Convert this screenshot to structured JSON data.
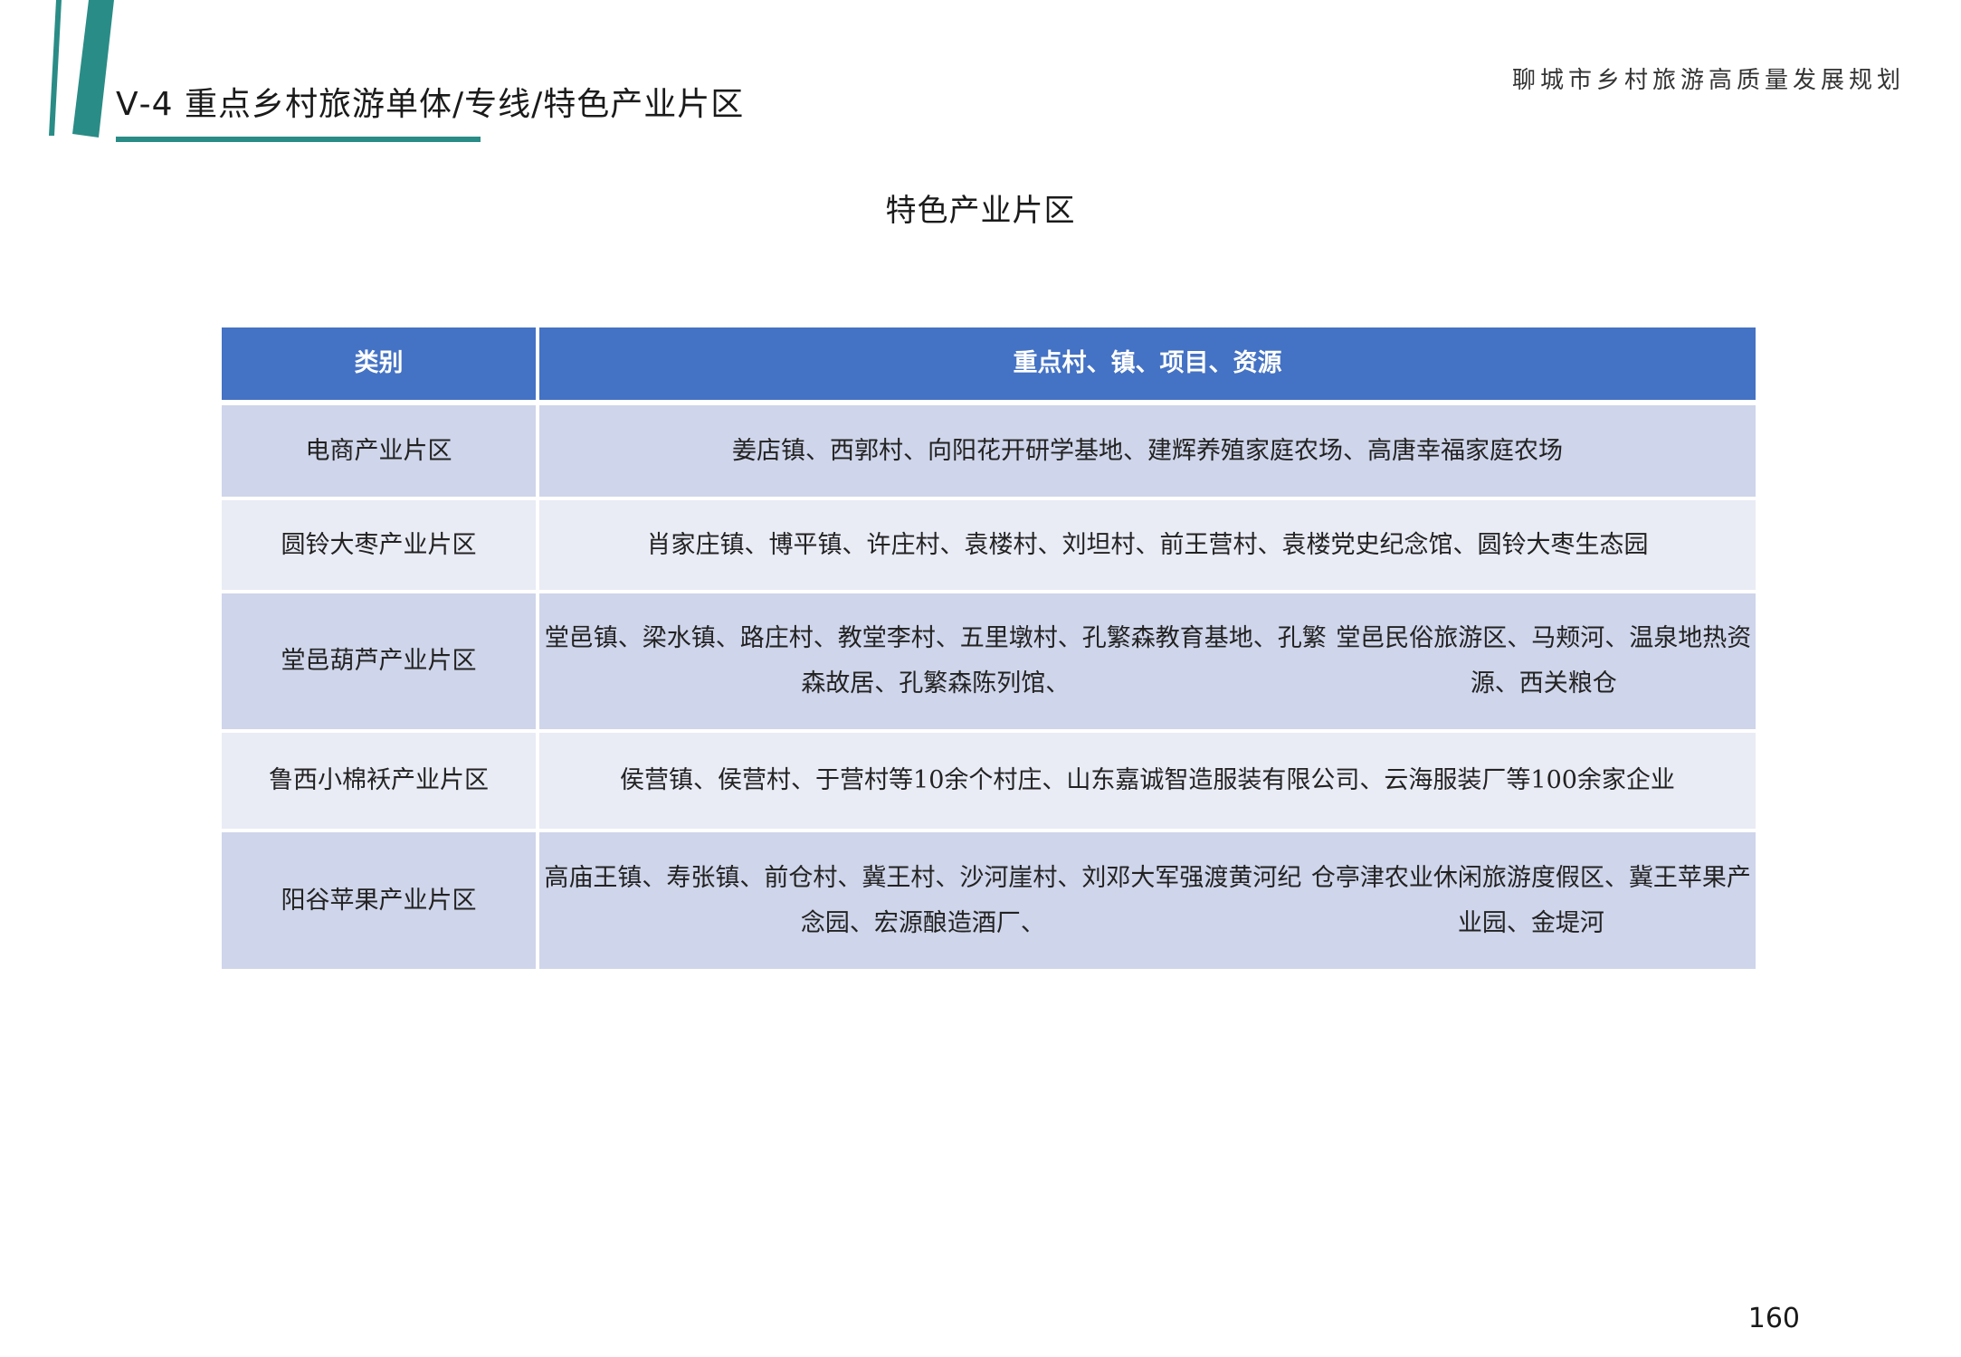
{
  "header": {
    "section_title": "Ⅴ-4 重点乡村旅游单体/专线/特色产业片区",
    "doc_title": "聊城市乡村旅游高质量发展规划"
  },
  "table_title": "特色产业片区",
  "table": {
    "headers": [
      "类别",
      "重点村、镇、项目、资源"
    ],
    "rows": [
      {
        "category": "电商产业片区",
        "lines": [
          "姜店镇、西郭村、向阳花开研学基地、建辉养殖家庭农场、高唐幸福家庭农场"
        ]
      },
      {
        "category": "圆铃大枣产业片区",
        "lines": [
          "肖家庄镇、博平镇、许庄村、袁楼村、刘坦村、前王营村、袁楼党史纪念馆、圆铃大枣生态园"
        ]
      },
      {
        "category": "堂邑葫芦产业片区",
        "lines": [
          "堂邑镇、梁水镇、路庄村、教堂李村、五里墩村、孔繁森教育基地、孔繁森故居、孔繁森陈列馆、",
          "堂邑民俗旅游区、马颊河、温泉地热资源、西关粮仓"
        ]
      },
      {
        "category": "鲁西小棉袄产业片区",
        "lines": [
          "侯营镇、侯营村、于营村等10余个村庄、山东嘉诚智造服装有限公司、云海服装厂等100余家企业"
        ]
      },
      {
        "category": "阳谷苹果产业片区",
        "lines": [
          "高庙王镇、寿张镇、前仓村、冀王村、沙河崖村、刘邓大军强渡黄河纪念园、宏源酿造酒厂、",
          "仓亭津农业休闲旅游度假区、冀王苹果产业园、金堤河"
        ]
      }
    ]
  },
  "page_number": "160",
  "colors": {
    "accent_teal": "#2a8c86",
    "header_blue": "#4472c4",
    "row_dark": "#cfd5ea",
    "row_light": "#e9ebf5"
  }
}
